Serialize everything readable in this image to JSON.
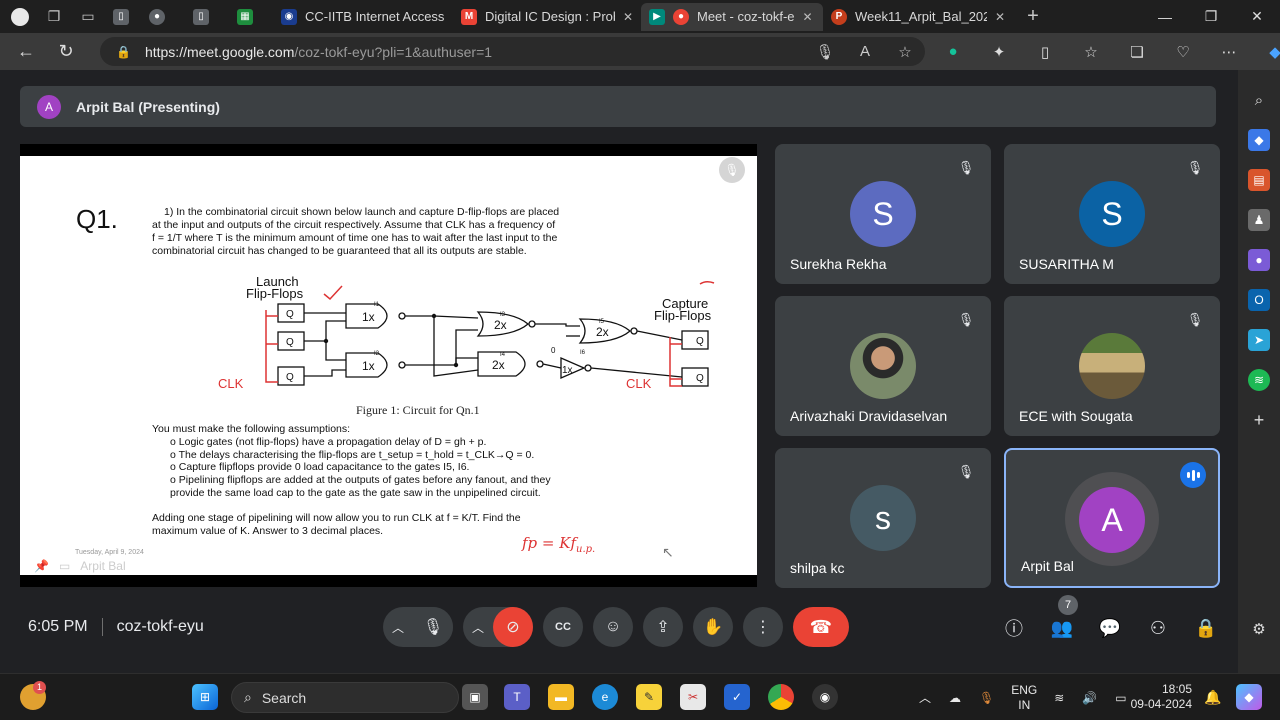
{
  "browser": {
    "tabs": [
      {
        "label": "",
        "icon": "pdf-icon",
        "color": "#5f6368"
      },
      {
        "label": "",
        "icon": "github-icon",
        "color": "#5f6368"
      },
      {
        "label": "",
        "icon": "pdf-icon",
        "color": "#5f6368"
      },
      {
        "label": "",
        "icon": "sheets-icon",
        "color": "#1e8e3e"
      },
      {
        "label": "CC-IITB Internet Access",
        "icon": "iitb-icon",
        "color": "#1a3c8f"
      },
      {
        "label": "Digital IC Design : Prob",
        "icon": "gmail-icon",
        "color": "#ea4335"
      },
      {
        "label": "Meet - coz-tokf-e",
        "icon": "meet-icon",
        "color": "#ea4335"
      },
      {
        "label": "Week11_Arpit_Bal_202",
        "icon": "powerpoint-icon",
        "color": "#c43e1c"
      }
    ],
    "url_host": "https://meet.google.com",
    "url_path": "/coz-tokf-eyu?pli=1&authuser=1"
  },
  "presenting": {
    "initial": "A",
    "label": "Arpit Bal (Presenting)"
  },
  "slide": {
    "heading": "Q1.",
    "para_line1": "1)  In the combinatorial circuit shown below launch and capture D-flip-flops are placed",
    "para_line2": "at the input and outputs of the circuit respectively. Assume that CLK has a frequency of",
    "para_line3": "f = 1/T where T is the minimum amount of time one has to wait after the last input to the",
    "para_line4": "combinatorial circuit has changed to be guaranteed that all its outputs are stable.",
    "launch_label": "Launch",
    "launch_label2": "Flip-Flops",
    "capture_label": "Capture",
    "capture_label2": "Flip-Flops",
    "clk_left": "CLK",
    "clk_right": "CLK",
    "gates": [
      {
        "name": "I1",
        "size": "1x"
      },
      {
        "name": "I2",
        "size": "1x"
      },
      {
        "name": "I3",
        "size": "2x"
      },
      {
        "name": "I4",
        "size": "2x"
      },
      {
        "name": "I5",
        "size": "2x"
      },
      {
        "name": "I6",
        "size": "1x"
      }
    ],
    "ff_label": "Q",
    "zero_label": "0",
    "figure_caption": "Figure 1:  Circuit for Qn.1",
    "assume_intro": "You must make the following assumptions:",
    "assumptions": [
      "Logic gates (not flip-flops) have a propagation delay of D = gh + p.",
      "The delays characterising the flip-flops are t_setup = t_hold = t_CLK→Q = 0.",
      "Capture flipflops provide 0 load capacitance to the gates I5, I6.",
      "Pipelining flipflops are added at the outputs of gates before any fanout, and they",
      "provide the same load cap to the gate as the gate saw in the unpipelined circuit."
    ],
    "final_line1": "Adding one stage of pipelining will now allow you to run CLK at f = K/T. Find the",
    "final_line2": "maximum value of K. Answer to 3 decimal places.",
    "date_tag": "Tuesday, April 9, 2024",
    "handwriting": "fp =  Kf",
    "handwriting_sub": "u.p.",
    "footer_name": "Arpit Bal"
  },
  "participants": [
    {
      "name": "Surekha Rekha",
      "initial": "S",
      "color": "#5c6bc0",
      "muted": true
    },
    {
      "name": "SUSARITHA M",
      "initial": "S",
      "color": "#0b62a4",
      "muted": true
    },
    {
      "name": "Arivazhaki Dravidaselvan",
      "initial": "",
      "color": "#8d8d8d",
      "muted": true
    },
    {
      "name": "ECE with Sougata",
      "initial": "",
      "color": "#6b5a3a",
      "muted": true
    },
    {
      "name": "shilpa kc",
      "initial": "s",
      "color": "#455a64",
      "muted": true
    },
    {
      "name": "Arpit Bal",
      "initial": "A",
      "color": "#a142c3",
      "muted": false
    }
  ],
  "meeting": {
    "time": "6:05 PM",
    "code": "coz-tokf-eyu",
    "people_count": "7"
  },
  "taskbar": {
    "search_placeholder": "Search",
    "notif_count": "1",
    "lang_top": "ENG",
    "lang_bottom": "IN",
    "clock_time": "18:05",
    "clock_date": "09-04-2024"
  }
}
